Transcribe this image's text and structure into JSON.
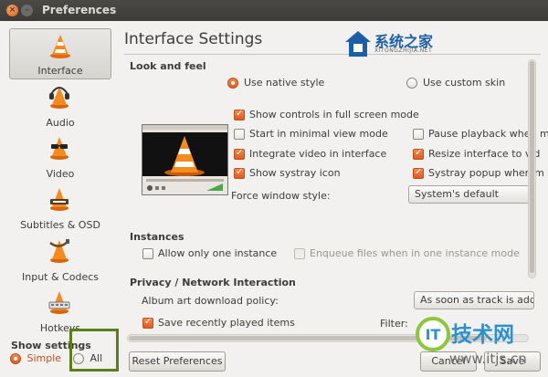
{
  "window": {
    "title": "Preferences"
  },
  "sidebar": {
    "items": [
      {
        "label": "Interface",
        "icon": "vlc-cone-icon",
        "active": true
      },
      {
        "label": "Audio",
        "icon": "cone-headphones-icon"
      },
      {
        "label": "Video",
        "icon": "cone-glasses-icon"
      },
      {
        "label": "Subtitles & OSD",
        "icon": "cone-subtitles-icon"
      },
      {
        "label": "Input & Codecs",
        "icon": "cone-plug-icon"
      },
      {
        "label": "Hotkeys",
        "icon": "cone-keyboard-icon"
      }
    ],
    "show_settings": {
      "title": "Show settings",
      "simple": "Simple",
      "all": "All",
      "selected": "Simple"
    }
  },
  "page": {
    "title": "Interface Settings",
    "look_and_feel": {
      "title": "Look and feel",
      "native_style": "Use native style",
      "custom_skin": "Use custom skin",
      "options_left": [
        {
          "label": "Show controls in full screen mode",
          "checked": true
        },
        {
          "label": "Start in minimal view mode",
          "checked": false
        },
        {
          "label": "Integrate video in interface",
          "checked": true
        },
        {
          "label": "Show systray icon",
          "checked": true
        }
      ],
      "options_right": [
        {
          "label": "Pause playback when m",
          "checked": false
        },
        {
          "label": "Resize interface to vid",
          "checked": true
        },
        {
          "label": "Systray popup when m",
          "checked": true
        }
      ],
      "force_window_style_label": "Force window style:",
      "force_window_style_value": "System's default"
    },
    "instances": {
      "title": "Instances",
      "one_instance": "Allow only one instance",
      "enqueue": "Enqueue files when in one instance mode"
    },
    "privacy": {
      "title": "Privacy / Network Interaction",
      "album_art_label": "Album art download policy:",
      "album_art_value": "As soon as track is added",
      "save_recent": "Save recently played items",
      "filter_label": "Filter:"
    }
  },
  "buttons": {
    "reset": "Reset Preferences",
    "cancel": "Cancel",
    "save": "Save"
  },
  "watermarks": {
    "top_logo": "系统之家",
    "top_logo_sub": "XITONGZHIJIA.NET",
    "bottom_logo": "技术网",
    "bottom_logo_badge": "IT",
    "bottom_url": "www.itjs.cn"
  },
  "colors": {
    "accent": "#e05a1d",
    "titlebar": "#3c3b37",
    "highlight_box": "#5b7e1c"
  }
}
